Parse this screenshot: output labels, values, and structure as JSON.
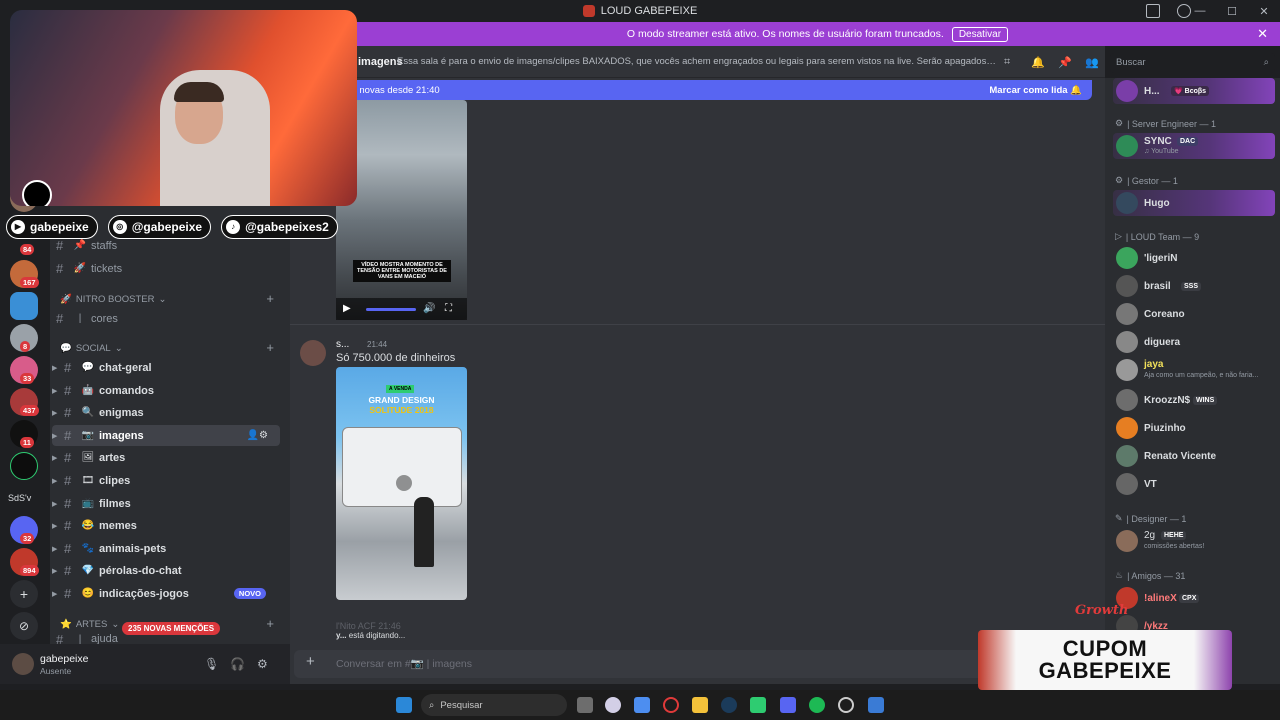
{
  "window": {
    "title": "LOUD GABEPEIXE"
  },
  "banner": {
    "text": "O modo streamer está ativo. Os nomes de usuário foram truncados.",
    "button": "Desativar"
  },
  "channel_header": {
    "name": "imagens",
    "topic": "Essa sala é para o envio de imagens/clipes BAIXADOS, que vocês achem engraçados ou legais para serem vistos na live. Serão apagados prints de o..."
  },
  "search": {
    "placeholder": "Buscar"
  },
  "new_messages": {
    "left": "s novas desde 21:40",
    "right": "Marcar como lida"
  },
  "servers": [
    {
      "badge": "84"
    },
    {
      "badge": "167"
    },
    {
      "badge": "8"
    },
    {
      "badge": "33"
    },
    {
      "badge": "437"
    },
    {
      "badge": "11"
    },
    {
      "badge": ""
    },
    {
      "text": "SdS'v"
    },
    {
      "badge": "32"
    },
    {
      "badge": "894"
    }
  ],
  "channel_list": {
    "top": [
      {
        "name": "staffs",
        "emoji": "📌"
      },
      {
        "name": "tickets",
        "emoji": "🚀"
      }
    ],
    "cat_booster": "NITRO BOOSTER",
    "booster_channels": [
      {
        "name": "cores",
        "emoji": ""
      }
    ],
    "cat_social": "SOCIAL",
    "social_channels": [
      {
        "name": "chat-geral",
        "emoji": "💬"
      },
      {
        "name": "comandos",
        "emoji": "🤖"
      },
      {
        "name": "enigmas",
        "emoji": "🔍"
      },
      {
        "name": "imagens",
        "emoji": "📷"
      },
      {
        "name": "artes",
        "emoji": "🖼"
      },
      {
        "name": "clipes",
        "emoji": "🎞"
      },
      {
        "name": "filmes",
        "emoji": "📺"
      },
      {
        "name": "memes",
        "emoji": "😂"
      },
      {
        "name": "animais-pets",
        "emoji": "🐾"
      },
      {
        "name": "pérolas-do-chat",
        "emoji": "💎"
      },
      {
        "name": "indicações-jogos",
        "emoji": "😊"
      }
    ],
    "novo_badge": "NOVO",
    "cat_artes": "ARTES",
    "last_partial": "ajuda",
    "mentions": "235 NOVAS MENÇÕES"
  },
  "user_panel": {
    "name": "gabepeixe",
    "status": "Ausente"
  },
  "messages": {
    "video_caption": "VÍDEO MOSTRA MOMENTO DE TENSÃO ENTRE MOTORISTAS DE VANS EM MACEIÓ",
    "author": "s...",
    "time": "21:44",
    "text": "Só 750.000 de dinheiros",
    "image_tag": "A VENDA",
    "image_title": "GRAND DESIGN",
    "image_subtitle": "SOLITUDE 2018",
    "typing_author": "l'Nito",
    "typing_tag": "ACF",
    "typing_time": "21:46",
    "typing": "está digitando..."
  },
  "composer": {
    "placeholder": "Conversar em #📷 | imagens"
  },
  "members": {
    "top_member": {
      "name": "H...",
      "tag": "💗 Bcoβs"
    },
    "groups": [
      {
        "label": "| Server Engineer — 1",
        "items": [
          {
            "name": "SYNC",
            "tag": "DAC",
            "sub": "♫ YouTube"
          }
        ]
      },
      {
        "label": "| Gestor — 1",
        "items": [
          {
            "name": "Hugo",
            "tag": "",
            "sub": ""
          }
        ]
      },
      {
        "label": "| LOUD Team — 9",
        "items": [
          {
            "name": "'ligeriN",
            "tag": "",
            "sub": ""
          },
          {
            "name": "brasil",
            "tag": "SSS",
            "sub": ""
          },
          {
            "name": "Coreano",
            "tag": "",
            "sub": ""
          },
          {
            "name": "diguera",
            "tag": "",
            "sub": ""
          },
          {
            "name": "jaya",
            "tag": "",
            "sub": "Aja como um campeão, e não faria..."
          },
          {
            "name": "KroozzN$",
            "tag": "WINS",
            "sub": ""
          },
          {
            "name": "Piuzinho",
            "tag": "",
            "sub": ""
          },
          {
            "name": "Renato Vicente",
            "tag": "",
            "sub": ""
          },
          {
            "name": "VT",
            "tag": "",
            "sub": ""
          }
        ]
      },
      {
        "label": "| Designer — 1",
        "items": [
          {
            "name": "2g",
            "tag": "HEHE",
            "sub": "comissões abertas!"
          }
        ]
      },
      {
        "label": "| Amigos — 31",
        "items": [
          {
            "name": "!alineX",
            "tag": "CPX",
            "sub": ""
          },
          {
            "name": "/ykzz",
            "tag": "",
            "sub": ""
          }
        ]
      }
    ]
  },
  "overlay": {
    "socials": [
      "gabepeixe",
      "@gabepeixe",
      "@gabepeixes2"
    ],
    "growth": "Growth",
    "coupon_line1": "CUPOM",
    "coupon_line2": "GABEPEIXE"
  },
  "taskbar": {
    "search": "Pesquisar"
  },
  "colors": {
    "accent": "#5865f2",
    "streamer_banner": "#9b3fd3",
    "mention": "#da373c"
  }
}
